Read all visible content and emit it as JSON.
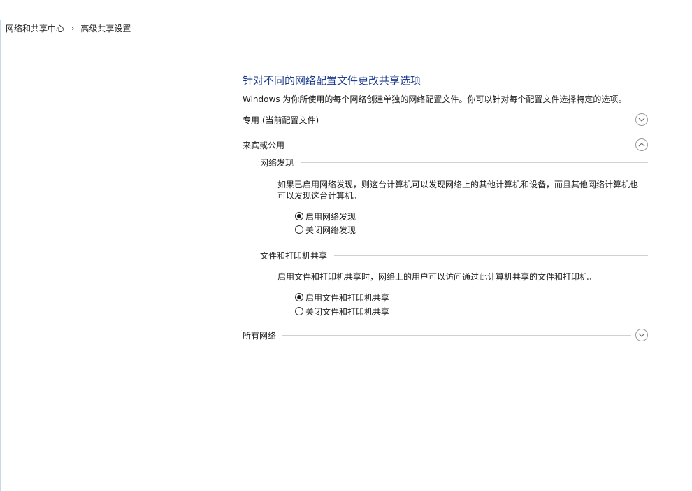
{
  "breadcrumb": {
    "items": [
      "网络和共享中心",
      "高级共享设置"
    ],
    "separator": "›"
  },
  "main": {
    "title": "针对不同的网络配置文件更改共享选项",
    "description": "Windows 为你所使用的每个网络创建单独的网络配置文件。你可以针对每个配置文件选择特定的选项。",
    "profiles": [
      {
        "label": "专用 (当前配置文件)",
        "state": "collapsed",
        "icon": "chevron-down-icon"
      },
      {
        "label": "来宾或公用",
        "state": "expanded",
        "icon": "chevron-up-icon"
      },
      {
        "label": "所有网络",
        "state": "collapsed",
        "icon": "chevron-down-icon"
      }
    ],
    "guest": {
      "network_discovery": {
        "heading": "网络发现",
        "text": "如果已启用网络发现，则这台计算机可以发现网络上的其他计算机和设备，而且其他网络计算机也可以发现这台计算机。",
        "options": [
          {
            "label": "启用网络发现",
            "selected": true
          },
          {
            "label": "关闭网络发现",
            "selected": false
          }
        ]
      },
      "file_printer_sharing": {
        "heading": "文件和打印机共享",
        "text": "启用文件和打印机共享时，网络上的用户可以访问通过此计算机共享的文件和打印机。",
        "options": [
          {
            "label": "启用文件和打印机共享",
            "selected": true
          },
          {
            "label": "关闭文件和打印机共享",
            "selected": false
          }
        ]
      }
    }
  },
  "colors": {
    "title": "#1e3d8f",
    "divider": "#d0d0d0",
    "text": "#1e1e1e"
  }
}
